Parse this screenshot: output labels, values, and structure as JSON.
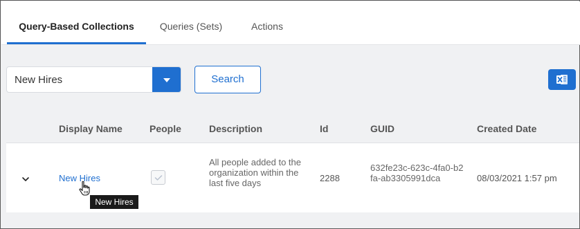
{
  "tabs": [
    {
      "label": "Query-Based Collections",
      "active": true
    },
    {
      "label": "Queries (Sets)",
      "active": false
    },
    {
      "label": "Actions",
      "active": false
    }
  ],
  "toolbar": {
    "select_value": "New Hires",
    "search_label": "Search",
    "export_icon": "excel-icon"
  },
  "table": {
    "columns": [
      "Display Name",
      "People",
      "Description",
      "Id",
      "GUID",
      "Created Date"
    ],
    "rows": [
      {
        "display_name": "New Hires",
        "people_checked": true,
        "description": "All people added to the organization within the last five days",
        "id": "2288",
        "guid": "632fe23c-623c-4fa0-b2fa-ab3305991dca",
        "created": "08/03/2021 1:57 pm"
      }
    ]
  },
  "tooltip": "New Hires",
  "colors": {
    "accent": "#1f6fd0",
    "background": "#f0f1f3",
    "tooltip": "#1a1a1a"
  }
}
